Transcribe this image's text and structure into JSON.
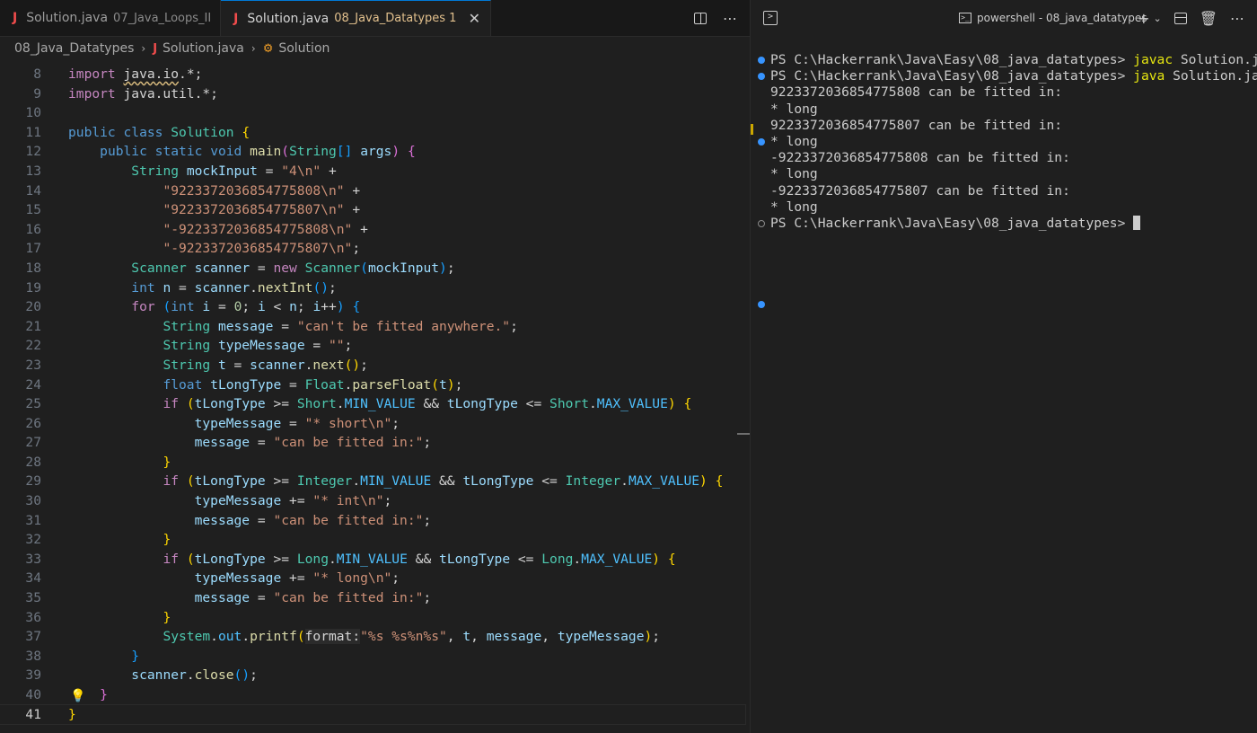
{
  "editor": {
    "tabs": [
      {
        "name": "Solution.java",
        "description": "07_Java_Loops_II",
        "badge": "",
        "active": false
      },
      {
        "name": "Solution.java",
        "description": "08_Java_Datatypes",
        "badge": "1",
        "active": true
      }
    ],
    "breadcrumb": {
      "folder": "08_Java_Datatypes",
      "file": "Solution.java",
      "symbol": "Solution"
    },
    "current_line": 41
  },
  "terminal": {
    "shell_name": "powershell - 08_java_datatypes",
    "lines": [
      {
        "prompt": "PS C:\\Hackerrank\\Java\\Easy\\08_java_datatypes> ",
        "cmd": "javac",
        "rest": " Solution.java"
      },
      {
        "prompt": "PS C:\\Hackerrank\\Java\\Easy\\08_java_datatypes> ",
        "cmd": "java",
        "rest": " Solution.java"
      },
      {
        "text": "9223372036854775808 can be fitted in:"
      },
      {
        "text": "* long"
      },
      {
        "text": "9223372036854775807 can be fitted in:"
      },
      {
        "text": "* long"
      },
      {
        "text": "-9223372036854775808 can be fitted in:"
      },
      {
        "text": "* long"
      },
      {
        "text": "-9223372036854775807 can be fitted in:"
      },
      {
        "text": "* long"
      },
      {
        "prompt": "PS C:\\Hackerrank\\Java\\Easy\\08_java_datatypes> "
      }
    ]
  }
}
